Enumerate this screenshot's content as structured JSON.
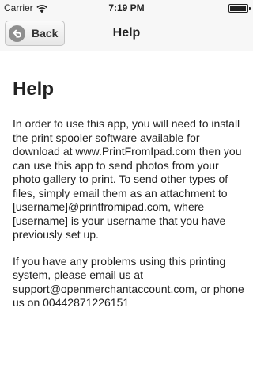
{
  "status_bar": {
    "carrier": "Carrier",
    "time": "7:19 PM"
  },
  "nav": {
    "back_label": "Back",
    "title": "Help"
  },
  "content": {
    "heading": "Help",
    "paragraphs": [
      "In order to use this app, you will need to install the print spooler software available for download at www.PrintFromIpad.com then you can use this app to send photos from your photo gallery to print. To send other types of files, simply email them as an attachment to [username]@printfromipad.com, where [username] is your username that you have previously set up.",
      "If you have any problems using this printing system, please email us at support@openmerchantaccount.com, or phone us on 00442871226151"
    ]
  },
  "icons": {
    "wifi": "wifi-icon",
    "battery": "battery-icon",
    "back": "back-arrow-icon"
  }
}
